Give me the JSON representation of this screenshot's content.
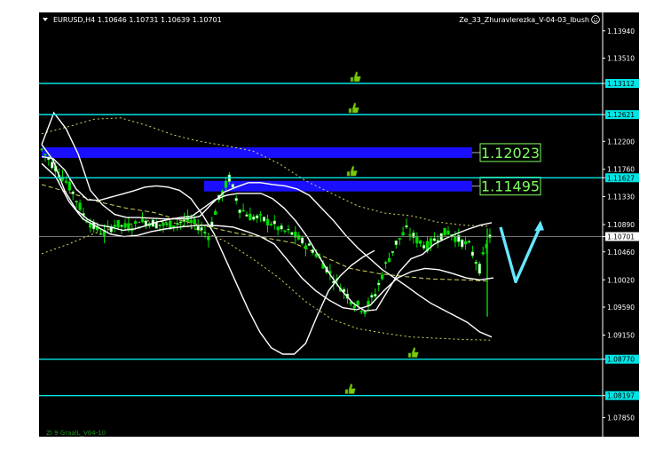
{
  "header": {
    "symbol_line": "EURUSD,H4  1.10646 1.10731 1.10639 1.10701",
    "expert_name": "Ze_33_Zhuravlerezka_V-04-03_Ibush",
    "indicator_label": "ZI 9 GraalL_V04-10"
  },
  "colors": {
    "background": "#000000",
    "text": "#ffffff",
    "candle_up": "#00dd00",
    "level_line": "#00e5e5",
    "zone": "#1a10ff",
    "envelope": "#ffffff",
    "dotted_band": "#d8d860",
    "signal_arrow": "#66e6ff",
    "zone_label": "#7fff5f",
    "thumb_icon": "#7cc80a"
  },
  "chart_data": {
    "type": "candlestick",
    "symbol": "EURUSD",
    "timeframe": "H4",
    "ohlc_current": {
      "open": 1.10646,
      "high": 1.10731,
      "low": 1.10639,
      "close": 1.10701
    },
    "ylim": [
      1.0755,
      1.1423
    ],
    "y_ticks": [
      1.1394,
      1.1351,
      1.13112,
      1.12621,
      1.122,
      1.1176,
      1.11627,
      1.1133,
      1.1089,
      1.10701,
      1.1046,
      1.1002,
      1.0959,
      1.0915,
      1.0877,
      1.08197,
      1.0785
    ],
    "y_tick_labels": [
      "1.13940",
      "1.13510",
      "1.13112",
      "1.12621",
      "1.12200",
      "1.11760",
      "1.11627",
      "1.11330",
      "1.10890",
      "1.10701",
      "1.10460",
      "1.10020",
      "1.09590",
      "1.09150",
      "1.08770",
      "1.08197",
      "1.07850"
    ],
    "current_price": 1.10701,
    "levels": [
      1.13112,
      1.12621,
      1.11627,
      1.0877,
      1.08197
    ],
    "zones": [
      {
        "label": "1.12023",
        "price": 1.12023
      },
      {
        "label": "1.11495",
        "price": 1.11495
      }
    ],
    "path": [
      1.1207,
      1.1185,
      1.1165,
      1.114,
      1.1105,
      1.1085,
      1.1075,
      1.109,
      1.1085,
      1.1088,
      1.1095,
      1.109,
      1.1087,
      1.1092,
      1.1095,
      1.1087,
      1.1072,
      1.1128,
      1.1162,
      1.1115,
      1.1102,
      1.1098,
      1.1092,
      1.108,
      1.1075,
      1.1062,
      1.105,
      1.1028,
      1.1005,
      1.0985,
      1.0965,
      1.0955,
      1.098,
      1.1025,
      1.106,
      1.108,
      1.1065,
      1.1055,
      1.107,
      1.1078,
      1.1065,
      1.1055,
      1.102,
      1.1072
    ],
    "envelope_outer": [
      [
        1.1196,
        1.1193,
        1.1175,
        1.1145,
        1.1128,
        1.1127,
        1.1132,
        1.1137,
        1.1142,
        1.1148,
        1.115,
        1.1148,
        1.1143,
        1.113,
        1.1105,
        1.1075,
        1.1035,
        1.0995,
        1.0955,
        1.092,
        1.0895,
        1.0885,
        1.0885,
        1.0902,
        1.0945,
        1.0985,
        1.1008,
        1.1025,
        1.1038,
        1.1048
      ],
      [
        1.1215,
        1.1265,
        1.124,
        1.12,
        1.1143,
        1.112,
        1.1105,
        1.11,
        1.11,
        1.1099,
        1.1098,
        1.1098,
        1.1098,
        1.1102,
        1.1122,
        1.114,
        1.1148,
        1.1155,
        1.1155,
        1.1152,
        1.115,
        1.1145,
        1.1135,
        1.1115,
        1.1095,
        1.1072,
        1.1052,
        1.1035,
        1.1018,
        1.1005,
        1.0992,
        1.0978,
        1.0965,
        1.0955,
        1.0945,
        1.0935,
        1.092,
        1.0912
      ]
    ],
    "envelope_inner": [
      [
        1.1215,
        1.119,
        1.1142,
        1.1112,
        1.1097,
        1.1088,
        1.1085,
        1.108,
        1.1082,
        1.1087,
        1.1093,
        1.1097,
        1.11,
        1.1102,
        1.1115,
        1.1128,
        1.1135,
        1.1138,
        1.1138,
        1.1138,
        1.113,
        1.1115,
        1.1095,
        1.107,
        1.104,
        1.101,
        1.0985,
        1.0965,
        1.0953,
        1.0955,
        1.0985,
        1.1015,
        1.1035,
        1.1042,
        1.1058,
        1.1067,
        1.1075,
        1.1082,
        1.1088,
        1.1092
      ],
      [
        1.1185,
        1.1165,
        1.1125,
        1.1098,
        1.1086,
        1.1074,
        1.107,
        1.1072,
        1.1078,
        1.1082,
        1.1085,
        1.1087,
        1.1088,
        1.1087,
        1.1085,
        1.1078,
        1.107,
        1.1058,
        1.1032,
        1.1005,
        1.0985,
        1.097,
        1.0958,
        1.0955,
        1.0962,
        1.0985,
        1.1005,
        1.1015,
        1.102,
        1.1018,
        1.1012,
        1.1005,
        1.1002,
        1.1005
      ]
    ],
    "dotted_upper": [
      1.1232,
      1.1243,
      1.1255,
      1.1257,
      1.1245,
      1.123,
      1.122,
      1.1213,
      1.1205,
      1.1185,
      1.1158,
      1.1138,
      1.1118,
      1.1107,
      1.1103,
      1.1093,
      1.1088,
      1.1086
    ],
    "dotted_lower": [
      1.1043,
      1.1058,
      1.1075,
      1.1087,
      1.1095,
      1.1092,
      1.108,
      1.1062,
      1.1035,
      1.1005,
      1.0968,
      1.094,
      1.0925,
      1.0918,
      1.0912,
      1.091,
      1.0908,
      1.0907
    ],
    "dotted_mid": [
      1.1152,
      1.1139,
      1.1125,
      1.1115,
      1.1108,
      1.1095,
      1.1085,
      1.1075,
      1.1068,
      1.106,
      1.104,
      1.102,
      1.1012,
      1.1007,
      1.1003,
      1.1002,
      1.1
    ],
    "signal_arrow": [
      1.1085,
      1.0999,
      1.1087
    ]
  }
}
